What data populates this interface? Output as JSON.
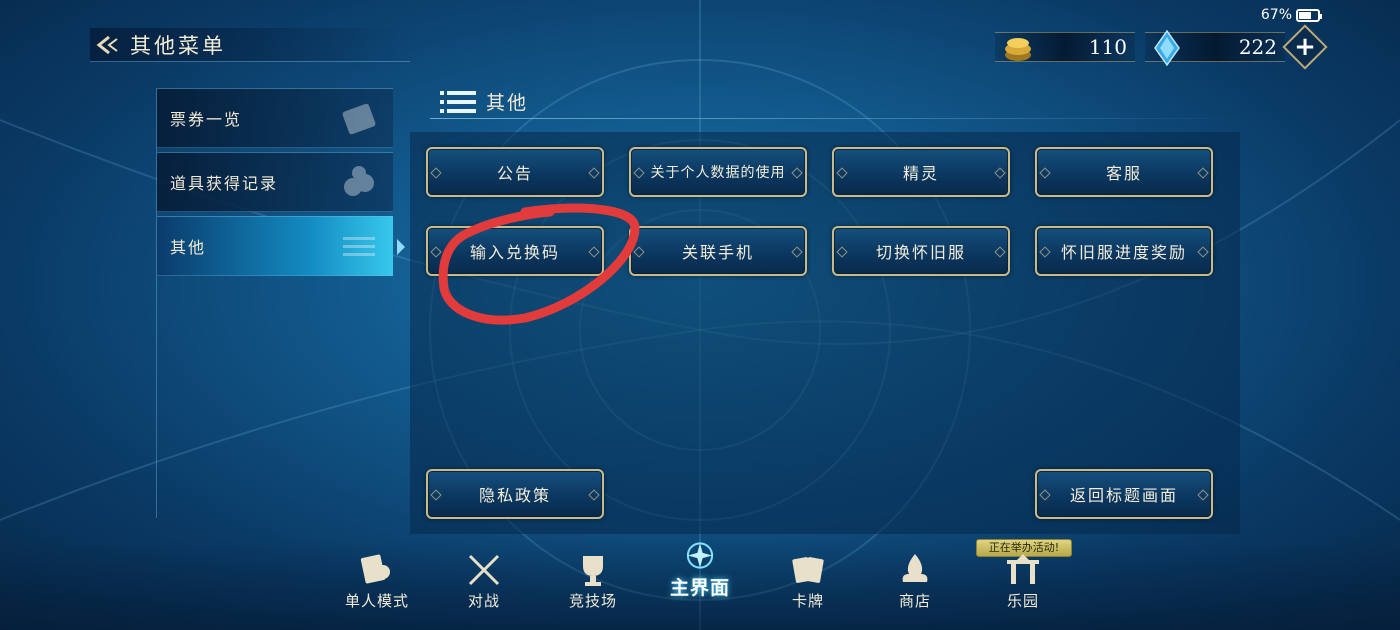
{
  "status": {
    "battery": "67%"
  },
  "header": {
    "title": "其他菜单"
  },
  "currency": {
    "gold": "110",
    "gem": "222"
  },
  "sidebar": {
    "items": [
      {
        "label": "票券一览",
        "icon": "ticket-icon"
      },
      {
        "label": "道具获得记录",
        "icon": "coins-icon"
      },
      {
        "label": "其他",
        "icon": "list-icon"
      }
    ],
    "active_index": 2
  },
  "section": {
    "title": "其他"
  },
  "buttons": {
    "announcement": "公告",
    "data_usage": "关于个人数据的使用",
    "spirit": "精灵",
    "support": "客服",
    "redeem": "输入兑换码",
    "link_phone": "关联手机",
    "switch_legacy": "切换怀旧服",
    "legacy_reward": "怀旧服进度奖励",
    "privacy": "隐私政策",
    "title_screen": "返回标题画面"
  },
  "nav": {
    "items": [
      {
        "label": "单人模式",
        "icon": "cards-avatar-icon"
      },
      {
        "label": "对战",
        "icon": "crossed-swords-icon"
      },
      {
        "label": "竞技场",
        "icon": "trophy-icon"
      },
      {
        "label": "主界面",
        "icon": "compass-emblem-icon"
      },
      {
        "label": "卡牌",
        "icon": "card-deck-icon"
      },
      {
        "label": "商店",
        "icon": "flame-shop-icon"
      },
      {
        "label": "乐园",
        "icon": "gate-icon"
      }
    ],
    "active_index": 3,
    "event_badge": "正在举办活动!"
  },
  "colors": {
    "accent_gold": "#c8ba8a",
    "active_cyan": "#37c8ec",
    "annotation_red": "#e23b3b"
  }
}
